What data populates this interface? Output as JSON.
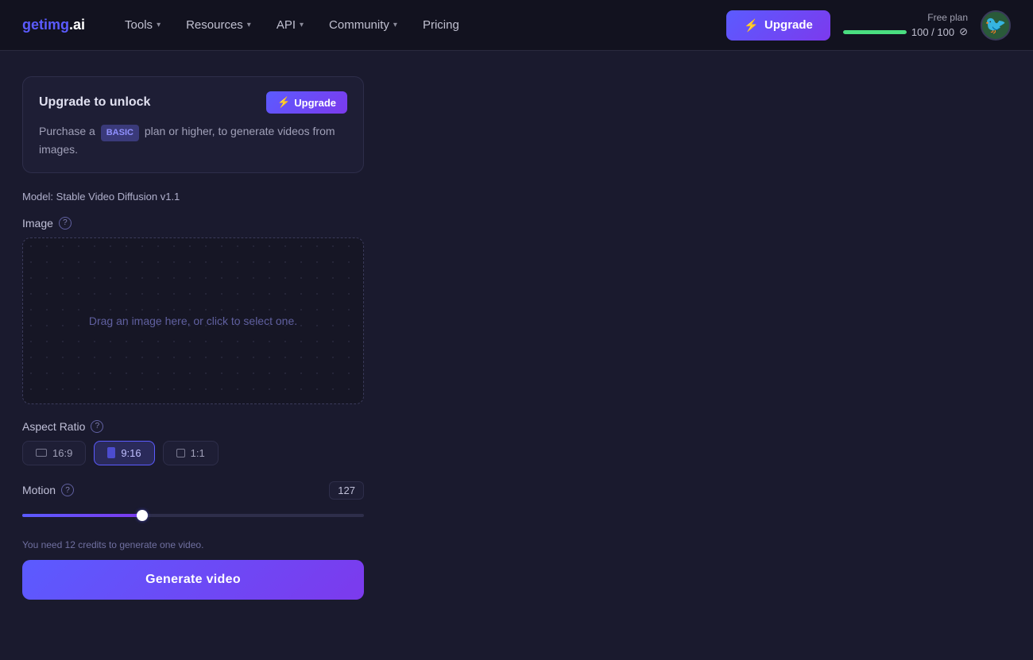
{
  "nav": {
    "logo": "getimg.ai",
    "items": [
      {
        "label": "Tools",
        "has_chevron": true
      },
      {
        "label": "Resources",
        "has_chevron": true
      },
      {
        "label": "API",
        "has_chevron": true
      },
      {
        "label": "Community",
        "has_chevron": true
      },
      {
        "label": "Pricing",
        "has_chevron": false
      }
    ],
    "upgrade_btn": "Upgrade",
    "plan_label": "Free plan",
    "plan_progress": "100 / 100",
    "plan_icon": "⊘"
  },
  "upgrade_banner": {
    "title": "Upgrade to unlock",
    "btn_label": "Upgrade",
    "text_before": "Purchase a",
    "badge": "BASIC",
    "text_after": "plan or higher, to generate videos from images."
  },
  "model": {
    "label": "Model:",
    "value": "Stable Video Diffusion v1.1"
  },
  "image_section": {
    "label": "Image",
    "placeholder": "Drag an image here, or click to select one."
  },
  "aspect_ratio": {
    "label": "Aspect Ratio",
    "options": [
      {
        "value": "16:9",
        "active": false,
        "shape": "wide"
      },
      {
        "value": "9:16",
        "active": true,
        "shape": "tall"
      },
      {
        "value": "1:1",
        "active": false,
        "shape": "square"
      }
    ]
  },
  "motion": {
    "label": "Motion",
    "value": "127"
  },
  "credits_note": "You need 12 credits to generate one video.",
  "generate_btn": "Generate video"
}
